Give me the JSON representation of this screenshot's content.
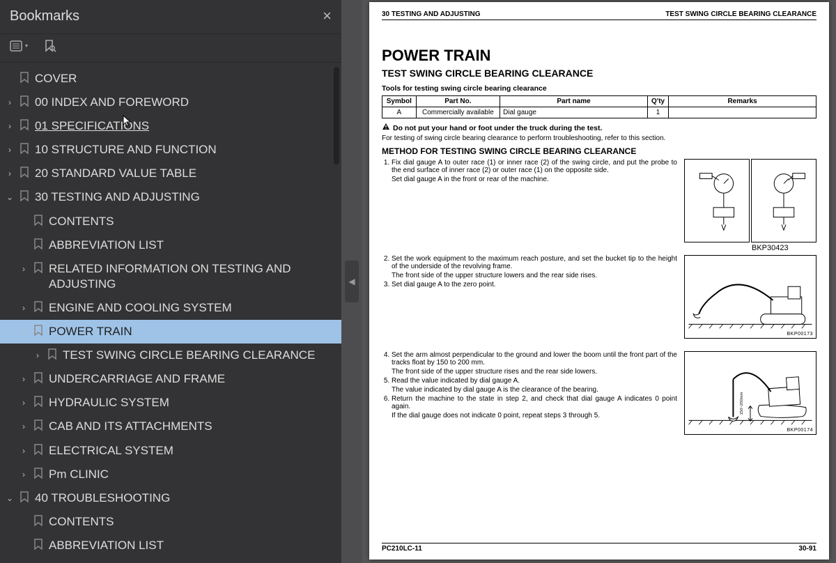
{
  "sidebar": {
    "title": "Bookmarks",
    "items": [
      {
        "label": "COVER",
        "indent": 0,
        "arrow": ""
      },
      {
        "label": "00 INDEX AND FOREWORD",
        "indent": 0,
        "arrow": "›"
      },
      {
        "label": "01 SPECIFICATIONS",
        "indent": 0,
        "arrow": "›",
        "underline": true
      },
      {
        "label": "10 STRUCTURE AND FUNCTION",
        "indent": 0,
        "arrow": "›"
      },
      {
        "label": "20 STANDARD VALUE TABLE",
        "indent": 0,
        "arrow": "›"
      },
      {
        "label": "30 TESTING AND ADJUSTING",
        "indent": 0,
        "arrow": "⌄"
      },
      {
        "label": "CONTENTS",
        "indent": 1,
        "arrow": ""
      },
      {
        "label": "ABBREVIATION LIST",
        "indent": 1,
        "arrow": ""
      },
      {
        "label": "RELATED INFORMATION ON TESTING AND ADJUSTING",
        "indent": 1,
        "arrow": "›"
      },
      {
        "label": "ENGINE AND COOLING SYSTEM",
        "indent": 1,
        "arrow": "›"
      },
      {
        "label": "POWER TRAIN",
        "indent": 1,
        "arrow": "⌄",
        "selected": true
      },
      {
        "label": "TEST SWING CIRCLE BEARING CLEARANCE",
        "indent": 2,
        "arrow": "›"
      },
      {
        "label": "UNDERCARRIAGE AND FRAME",
        "indent": 1,
        "arrow": "›"
      },
      {
        "label": "HYDRAULIC SYSTEM",
        "indent": 1,
        "arrow": "›"
      },
      {
        "label": "CAB AND ITS ATTACHMENTS",
        "indent": 1,
        "arrow": "›"
      },
      {
        "label": "ELECTRICAL SYSTEM",
        "indent": 1,
        "arrow": "›"
      },
      {
        "label": "Pm CLINIC",
        "indent": 1,
        "arrow": "›"
      },
      {
        "label": "40 TROUBLESHOOTING",
        "indent": 0,
        "arrow": "⌄"
      },
      {
        "label": "CONTENTS",
        "indent": 1,
        "arrow": ""
      },
      {
        "label": "ABBREVIATION LIST",
        "indent": 1,
        "arrow": ""
      }
    ]
  },
  "page": {
    "top_left": "30 TESTING AND ADJUSTING",
    "top_right": "TEST SWING CIRCLE BEARING CLEARANCE",
    "h1": "POWER TRAIN",
    "h2": "TEST SWING CIRCLE BEARING CLEARANCE",
    "tools_caption": "Tools for testing swing circle bearing clearance",
    "table": {
      "headers": [
        "Symbol",
        "Part No.",
        "Part name",
        "Q'ty",
        "Remarks"
      ],
      "row": {
        "symbol": "A",
        "part_no": "Commercially available",
        "part_name": "Dial gauge",
        "qty": "1",
        "remarks": ""
      }
    },
    "warning": "Do not put your hand or foot under the truck during the test.",
    "note": "For testing of swing circle bearing clearance to perform troubleshooting, refer to this section.",
    "h3": "METHOD FOR TESTING SWING CIRCLE BEARING CLEARANCE",
    "steps": {
      "s1a": "Fix dial gauge A to outer race (1) or inner race (2) of the swing circle, and put the probe to the end surface of inner race (2) or outer race (1) on the opposite side.",
      "s1b": "Set dial gauge A in the front or rear of the machine.",
      "s2a": "Set the work equipment to the maximum reach posture, and set the bucket tip to the height of the underside of the revolving frame.",
      "s2b": "The front side of the upper structure lowers and the rear side rises.",
      "s3": "Set dial gauge A to the zero point.",
      "s4a": "Set the arm almost perpendicular to the ground and lower the boom until the front part of the tracks float by 150 to 200 mm.",
      "s4b": "The front side of the upper structure rises and the rear side lowers.",
      "s5a": "Read the value indicated by dial gauge A.",
      "s5b": "The value indicated by dial gauge A is the clearance of the bearing.",
      "s6a": "Return the machine to the state in step 2, and check that dial gauge A indicates 0 point again.",
      "s6b": "If the dial gauge does not indicate 0 point, repeat steps 3 through 5."
    },
    "fig_ids": {
      "f1": "BKP30423",
      "f2": "BKP00173",
      "f3": "BKP00174"
    },
    "footer_left": "PC210LC-11",
    "footer_right": "30-91"
  }
}
